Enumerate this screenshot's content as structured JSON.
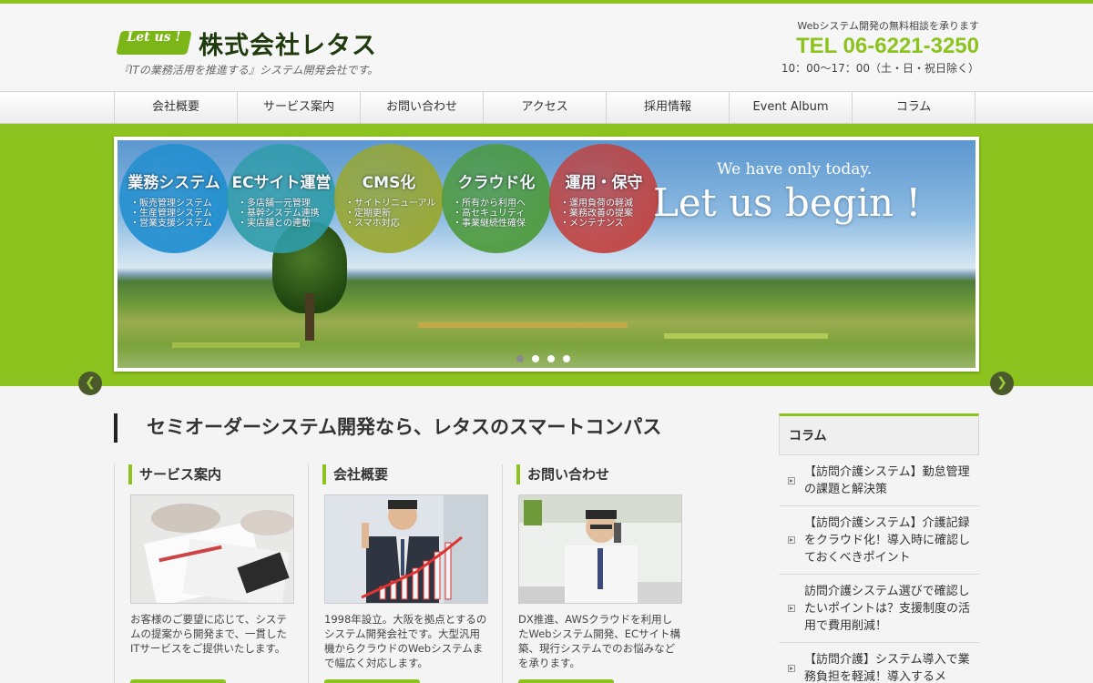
{
  "header": {
    "logo_badge": "Let us !",
    "company_name": "株式会社レタス",
    "tagline": "『ITの業務活用を推進する』システム開発会社です。",
    "contact_note": "Webシステム開発の無料相談を承ります",
    "tel": "TEL 06-6221-3250",
    "hours": "10：00～17：00（土・日・祝日除く）"
  },
  "nav": {
    "items": [
      "会社概要",
      "サービス案内",
      "お問い合わせ",
      "アクセス",
      "採用情報",
      "Event Album",
      "コラム"
    ]
  },
  "hero": {
    "slogan_small": "We have only today.",
    "slogan_big": "Let us begin !",
    "circles": [
      {
        "title": "業務システム",
        "items": [
          "・販売管理システム",
          "・生産管理システム",
          "・営業支援システム"
        ],
        "color": "#1f8ecf"
      },
      {
        "title": "ECサイト運営",
        "items": [
          "・多店舗一元管理",
          "・基幹システム連携",
          "・実店舗との連動"
        ],
        "color": "#2e9ca8"
      },
      {
        "title": "CMS化",
        "items": [
          "・サイトリニューアル",
          "・定期更新",
          "・スマホ対応"
        ],
        "color": "#9aa72c"
      },
      {
        "title": "クラウド化",
        "items": [
          "・所有から利用へ",
          "・高セキュリティ",
          "・事業継続性確保"
        ],
        "color": "#4d9a3a"
      },
      {
        "title": "運用・保守",
        "items": [
          "・運用負荷の軽減",
          "・業務改善の提案",
          "・メンテナンス"
        ],
        "color": "#c2413e"
      }
    ],
    "dot_count": 4,
    "active_dot": 0
  },
  "main": {
    "heading": "セミオーダーシステム開発なら、レタスのスマートコンパス",
    "cards": [
      {
        "title": "サービス案内",
        "text": "お客様のご要望に応じて、システムの提案から開発まで、一貫したITサービスをご提供いたします。",
        "image": "documents-photo"
      },
      {
        "title": "会社概要",
        "text": "1998年設立。大阪を拠点とするのシステム開発会社です。大型汎用機からクラウドのWebシステムまで幅広く対応します。",
        "image": "businessman-chart-photo"
      },
      {
        "title": "お問い合わせ",
        "text": "DX推進、AWSクラウドを利用したWebシステム開発、ECサイト構築、現行システムでのお悩みなどを承ります。",
        "image": "operator-phone-photo"
      }
    ]
  },
  "sidebar": {
    "title": "コラム",
    "items": [
      "【訪問介護システム】勤怠管理の課題と解決策",
      "【訪問介護システム】介護記録をクラウド化！導入時に確認しておくべきポイント",
      "訪問介護システム選びで確認したいポイントは？支援制度の活用で費用削減！",
      "【訪問介護】システム導入で業務負担を軽減！導入するメ"
    ]
  },
  "colors": {
    "accent": "#8cc31e",
    "dark_text": "#333333"
  }
}
